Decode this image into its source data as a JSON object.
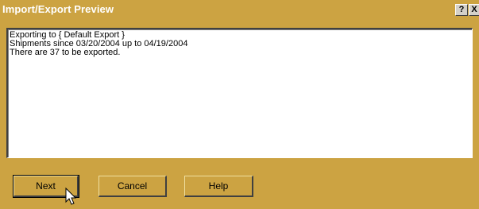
{
  "window": {
    "title": "Import/Export Preview",
    "help_glyph": "?",
    "close_glyph": "X"
  },
  "preview": {
    "lines": [
      "Exporting to { Default Export }",
      "Shipments since 03/20/2004 up to 04/19/2004",
      "There are 37 to be exported."
    ]
  },
  "buttons": {
    "next": "Next",
    "cancel": "Cancel",
    "help": "Help"
  },
  "icons": {
    "help": "question-icon",
    "close": "close-icon",
    "cursor": "mouse-pointer-icon"
  },
  "colors": {
    "accent": "#cca342",
    "face": "#d4d0c8",
    "title_text": "#ffffff"
  }
}
